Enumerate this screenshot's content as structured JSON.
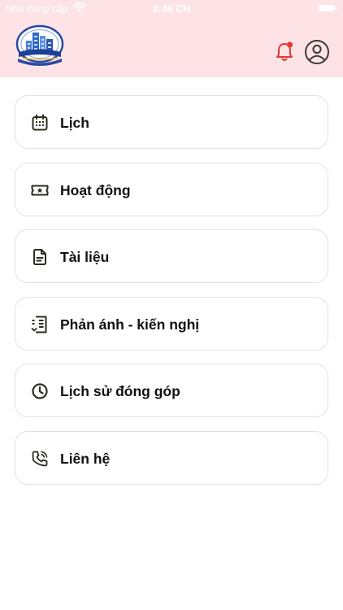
{
  "status_bar": {
    "carrier": "Nhà cung cấp",
    "time": "2:46 CH"
  },
  "header": {
    "logo_icon": "building-logo-icon",
    "notification_icon": "bell-icon",
    "notification_has_badge": true,
    "profile_icon": "user-circle-icon"
  },
  "colors": {
    "header_bg": "#fde3e6",
    "bell": "#e53935",
    "icon_dark": "#2b2b1f",
    "card_border": "#dde3ec"
  },
  "menu": {
    "items": [
      {
        "label": "Lịch",
        "icon": "calendar-icon"
      },
      {
        "label": "Hoạt động",
        "icon": "ticket-star-icon"
      },
      {
        "label": "Tài liệu",
        "icon": "document-icon"
      },
      {
        "label": "Phản ánh - kiến nghị",
        "icon": "feedback-list-icon"
      },
      {
        "label": "Lịch sử đóng góp",
        "icon": "history-clock-icon"
      },
      {
        "label": "Liên hệ",
        "icon": "phone-icon"
      }
    ]
  }
}
